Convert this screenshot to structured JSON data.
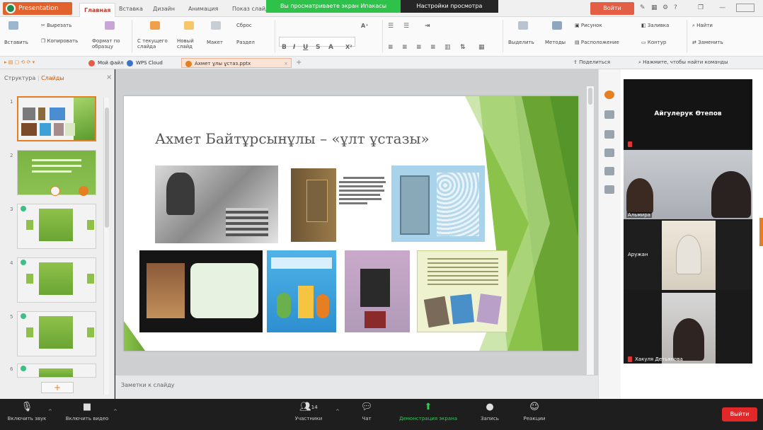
{
  "titlebar": {
    "app_name": "Presentation",
    "menu_tabs": [
      "Главная",
      "Вставка",
      "Дизайн",
      "Анимация",
      "Показ слайд"
    ],
    "share_notice": "Вы просматриваете экран Ипакасы",
    "view_settings": "Настройки просмотра",
    "exit_label": "Войти"
  },
  "ribbon": {
    "insert_label": "Вставить",
    "cut_label": "Вырезать",
    "copy_label": "Копировать",
    "format_painter_label": "Формат по образцу",
    "from_start_label": "С текущего слайда",
    "new_slide_label": "Новый слайд",
    "layout_label": "Макет",
    "reset_label": "Сброс",
    "section_label": "Раздел",
    "select_label": "Выделить",
    "method_label": "Методы",
    "drawing_label": "Рисунок",
    "arrange_label": "Расположение",
    "fill_label": "Заливка",
    "outline_label": "Контур",
    "find_label": "Найти",
    "replace_label": "Заменить"
  },
  "tabs": {
    "home": "Мой файл",
    "cloud": "WPS Cloud",
    "file": "Ахмет ұлы ұстаз.pptx",
    "share": "Поделиться",
    "search_placeholder": "Нажмите, чтобы найти команды"
  },
  "left_panel": {
    "outline_label": "Структура",
    "slides_label": "Слайды",
    "slide_numbers": [
      "1",
      "2",
      "3",
      "4",
      "5",
      "6"
    ]
  },
  "slide": {
    "title": "Ахмет Байтұрсынұлы – «ұлт ұстазы»",
    "notes_placeholder": "Заметки к слайду"
  },
  "video": {
    "speaker": "Айгулерук Өтепов",
    "participant_2": "Альмира",
    "participant_3": "Аружан",
    "participant_4": "Хакуля Детьянова"
  },
  "bottombar": {
    "mute_label": "Включить звук",
    "video_label": "Включить видео",
    "participants_label": "Участники",
    "participants_count": "14",
    "chat_label": "Чат",
    "share_label": "Демонстрация экрана",
    "record_label": "Запись",
    "reactions_label": "Реакции",
    "end_label": "Выйти"
  },
  "colors": {
    "accent_orange": "#e2622d",
    "slide_green": "#7cb342",
    "share_green": "#2ecc52",
    "end_red": "#e02828"
  }
}
